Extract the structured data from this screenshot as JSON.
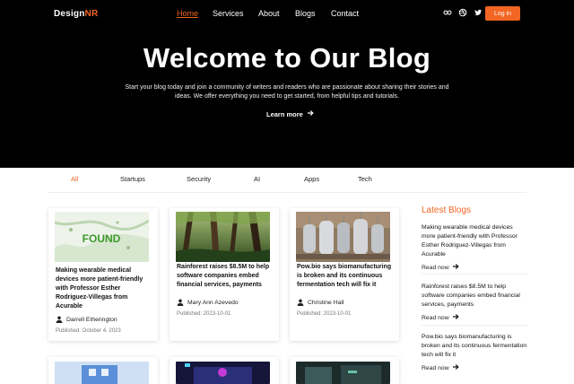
{
  "brand": {
    "name": "Design",
    "accent": "NR",
    "accent_color": "#f26522"
  },
  "nav": {
    "items": [
      "Home",
      "Services",
      "About",
      "Blogs",
      "Contact"
    ],
    "active": "Home"
  },
  "social": {
    "icons": [
      "infinity-icon",
      "dribbble-icon",
      "twitter-icon"
    ]
  },
  "header": {
    "login_label": "Log in"
  },
  "hero": {
    "title": "Welcome to Our Blog",
    "subtitle": "Start your blog today and join a community of writers and readers who are passionate about sharing their stories and ideas. We offer everything you need to get started, from helpful tips and tutorials.",
    "cta": "Learn more"
  },
  "categories": [
    "All",
    "Startups",
    "Security",
    "AI",
    "Apps",
    "Tech"
  ],
  "cards": [
    {
      "title": "Making wearable medical devices more patient-friendly with Professor Esther Rodriguez-Villegas from Acurable",
      "author": "Darrell Etherington",
      "published": "Published: October 4, 2023",
      "thumb_text": "FOUND"
    },
    {
      "title": "Rainforest raises $8.5M to help software companies embed financial services, payments",
      "author": "Mary Ann Azevedo",
      "published": "Published: 2023-10-01"
    },
    {
      "title": "Pow.bio says biomanufacturing is broken and its continuous fermentation tech will fix it",
      "author": "Christine Hall",
      "published": "Published: 2023-10-01"
    }
  ],
  "sidebar": {
    "title": "Latest Blogs",
    "items": [
      {
        "title": "Making wearable medical devices more patient-friendly with Professor Esther Rodriguez-Villegas from Acurable",
        "link": "Read now"
      },
      {
        "title": "Rainforest raises $8.5M to help software companies embed financial services, payments",
        "link": "Read now"
      },
      {
        "title": "Pow.bio says biomanufacturing is broken and its continuous fermentation tech will fix it",
        "link": "Read now"
      }
    ]
  }
}
